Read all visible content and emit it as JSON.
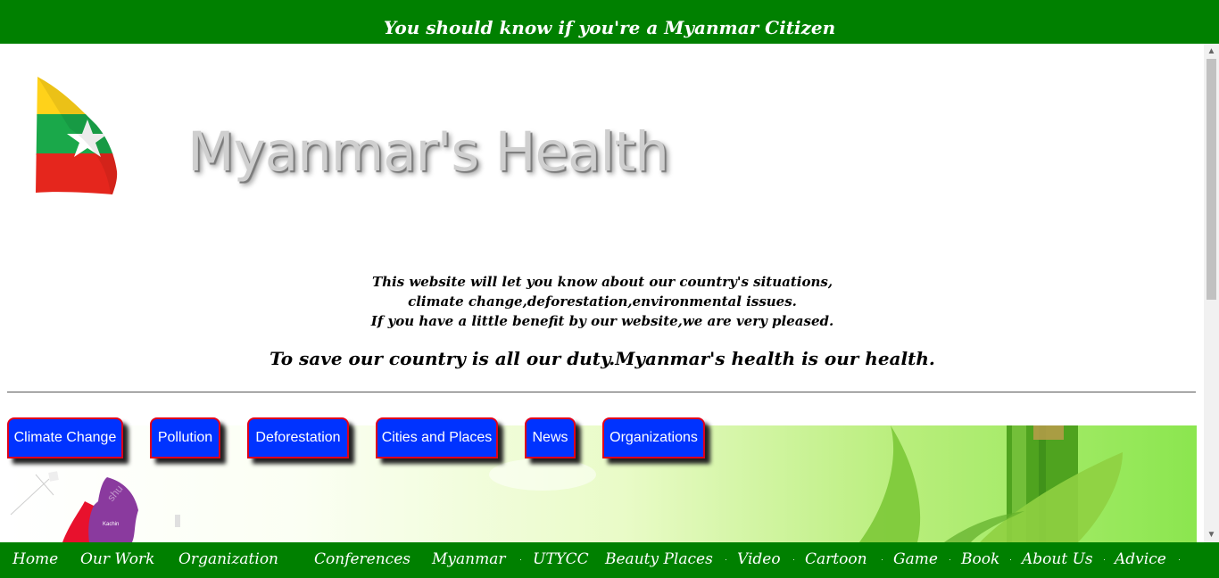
{
  "header": {
    "tagline": "You should know if you're a Myanmar Citizen"
  },
  "brand": {
    "title": "Myanmar's Health"
  },
  "intro": {
    "line1": "This website will let you know about our country's situations,",
    "line2": "climate change,deforestation,environmental issues.",
    "line3": "If you have a little benefit by our website,we are very pleased."
  },
  "duty": "To save our country is all our duty.Myanmar's health is our health.",
  "nav": [
    {
      "label": "Climate Change"
    },
    {
      "label": "Pollution"
    },
    {
      "label": "Deforestation"
    },
    {
      "label": "Cities and Places"
    },
    {
      "label": "News"
    },
    {
      "label": "Organizations"
    }
  ],
  "map": {
    "region_label": "Kachin"
  },
  "footer_nav": [
    {
      "label": "Home"
    },
    {
      "label": "Our Work"
    },
    {
      "label": "Organization"
    },
    {
      "label": "Conferences"
    },
    {
      "label": "Myanmar"
    },
    {
      "label": "UTYCC"
    },
    {
      "label": "Beauty Places"
    },
    {
      "label": "Video"
    },
    {
      "label": "Cartoon"
    },
    {
      "label": "Game"
    },
    {
      "label": "Book"
    },
    {
      "label": "About Us"
    },
    {
      "label": "Advice"
    }
  ],
  "colors": {
    "bar_green": "#008000",
    "button_blue": "#0033ff",
    "button_border": "#e0001b"
  },
  "icons": {
    "scroll_up": "▲",
    "scroll_down": "▼"
  }
}
